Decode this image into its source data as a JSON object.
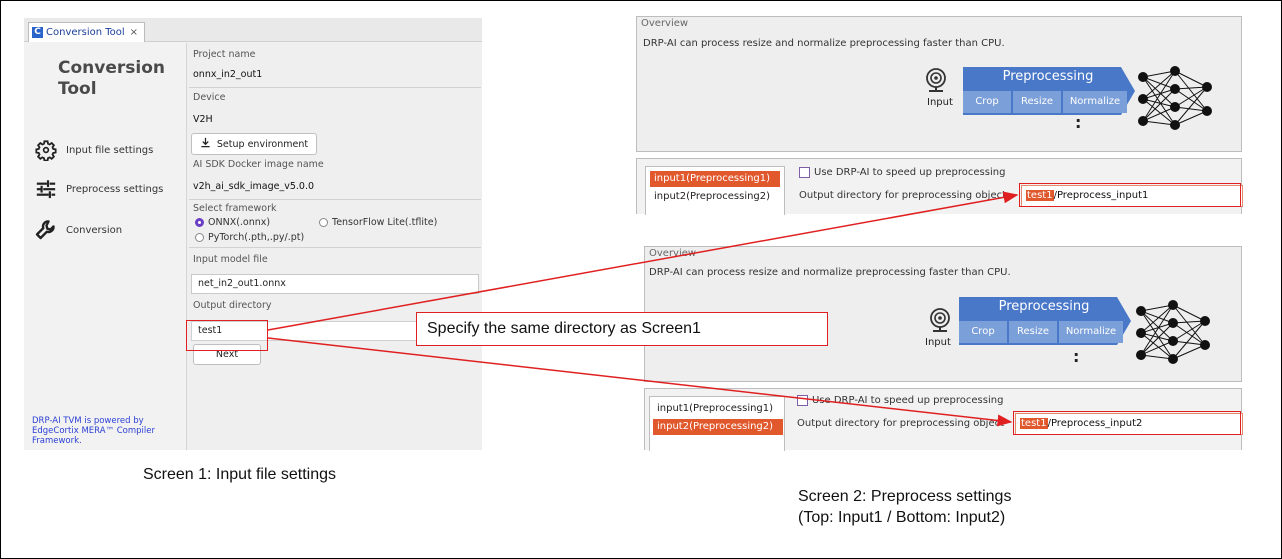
{
  "screen1": {
    "tab_label": "Conversion Tool",
    "tab_close": "×",
    "tab_logo": "C",
    "app_title_line1": "Conversion",
    "app_title_line2": "Tool",
    "nav": [
      {
        "label": "Input file settings",
        "icon": "gear-icon"
      },
      {
        "label": "Preprocess settings",
        "icon": "sliders-icon"
      },
      {
        "label": "Conversion",
        "icon": "wrench-icon"
      }
    ],
    "footer": "DRP-AI TVM is powered by EdgeCortix MERA™ Compiler Framework.",
    "project_name_label": "Project name",
    "project_name_value": "onnx_in2_out1",
    "device_label": "Device",
    "device_value": "V2H",
    "setup_button": "Setup environment",
    "docker_label": "AI SDK Docker image name",
    "docker_value": "v2h_ai_sdk_image_v5.0.0",
    "framework_label": "Select framework",
    "framework_options": [
      "ONNX(.onnx)",
      "TensorFlow Lite(.tflite)",
      "PyTorch(.pth,.py/.pt)"
    ],
    "framework_selected": 0,
    "model_file_label": "Input model file",
    "model_file_value": "net_in2_out1.onnx",
    "output_dir_label": "Output directory",
    "output_dir_value": "test1",
    "next_button": "Next"
  },
  "screen2_top": {
    "overview_title": "Overview",
    "overview_desc": "DRP-AI can process resize and normalize preprocessing faster than CPU.",
    "pipeline_title": "Preprocessing",
    "pipeline_steps": [
      "Crop",
      "Resize",
      "Normalize"
    ],
    "camera_label": "Input",
    "dots": ":",
    "inputs": [
      "input1(Preprocessing1)",
      "input2(Preprocessing2)"
    ],
    "selected_input": 0,
    "checkbox_label": "Use DRP-AI to speed up preprocessing",
    "output_dir_label": "Output directory for preprocessing object",
    "output_dir_highlight": "test1",
    "output_dir_rest": "/Preprocess_input1"
  },
  "screen2_bottom": {
    "overview_title": "Overview",
    "overview_desc": "DRP-AI can process resize and normalize preprocessing faster than CPU.",
    "pipeline_title": "Preprocessing",
    "pipeline_steps": [
      "Crop",
      "Resize",
      "Normalize"
    ],
    "camera_label": "Input",
    "dots": ":",
    "inputs": [
      "input1(Preprocessing1)",
      "input2(Preprocessing2)"
    ],
    "selected_input": 1,
    "checkbox_label": "Use DRP-AI to speed up preprocessing",
    "output_dir_label": "Output directory for preprocessing object",
    "output_dir_highlight": "test1",
    "output_dir_rest": "/Preprocess_input2"
  },
  "callout": "Specify the same directory as Screen1",
  "captions": {
    "screen1": "Screen 1: Input file settings",
    "screen2_line1": "Screen 2: Preprocess settings",
    "screen2_line2": "(Top: Input1 / Bottom: Input2)"
  },
  "colors": {
    "accent_red": "#e02020",
    "selection_orange": "#e0582c",
    "pipeline_blue": "#4a78c9",
    "footer_link_blue": "#2b3fd4"
  }
}
